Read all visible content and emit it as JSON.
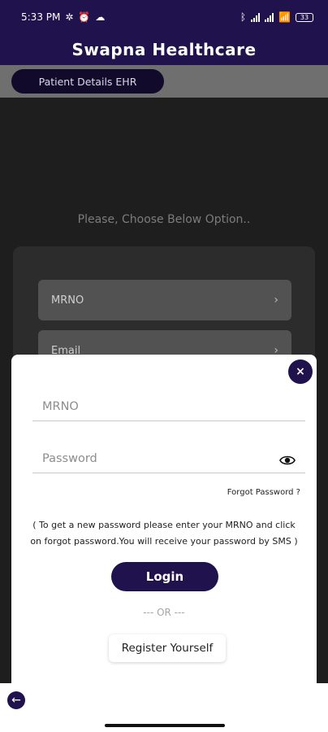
{
  "status_bar": {
    "time": "5:33 PM",
    "left_icons": [
      "bluetooth-icon"
    ],
    "battery": "33"
  },
  "app": {
    "title": "Swapna Healthcare"
  },
  "sub_header": {
    "pill_label": "Patient Details EHR"
  },
  "background": {
    "choose_text": "Please, Choose Below Option..",
    "options": [
      "MRNO",
      "Email"
    ]
  },
  "modal": {
    "close_label": "×",
    "mrno_placeholder": "MRNO",
    "password_placeholder": "Password",
    "forgot_label": "Forgot Password ?",
    "info_text": "( To get a new password please enter your MRNO and click on forgot password.You will receive your password by SMS )",
    "login_label": "Login",
    "or_text": "--- OR ---",
    "register_label": "Register Yourself"
  },
  "colors": {
    "brand": "#20124d",
    "modal_bg": "#ffffff"
  }
}
